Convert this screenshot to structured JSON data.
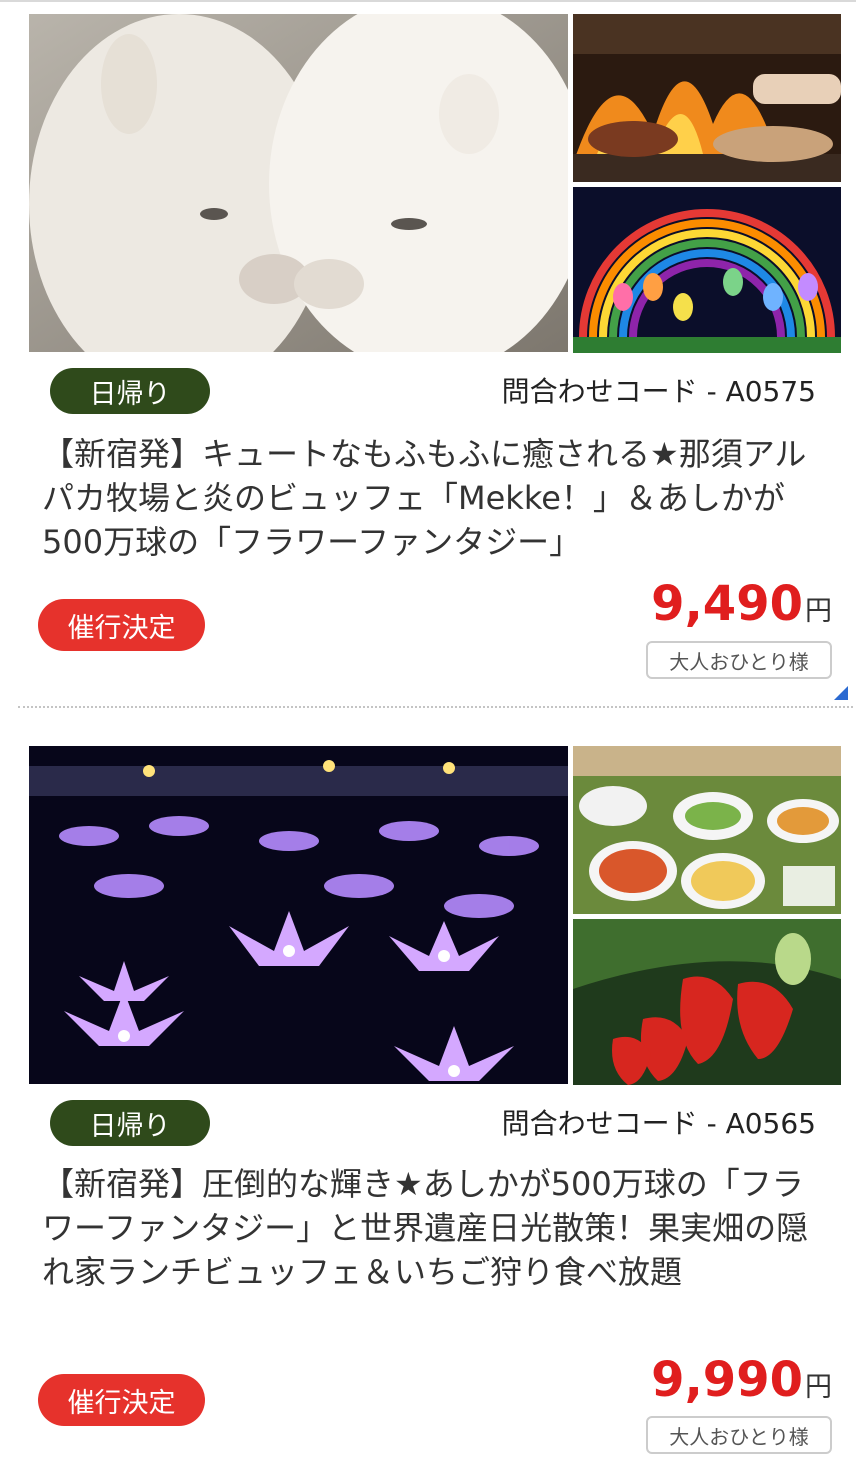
{
  "tours": [
    {
      "type_badge": "日帰り",
      "code": "問合わせコード - A0575",
      "title": "【新宿発】キュートなもふもふに癒される★那須アルパカ牧場と炎のビュッフェ「Mekke！」＆あしかが500万球の「フラワーファンタジー」",
      "status_badge": "催行決定",
      "price": "9,490",
      "currency": "円",
      "per_person": "大人おひとり様"
    },
    {
      "type_badge": "日帰り",
      "code": "問合わせコード - A0565",
      "title": "【新宿発】圧倒的な輝き★あしかが500万球の「フラワーファンタジー」と世界遺産日光散策！果実畑の隠れ家ランチビュッフェ＆いちご狩り食べ放題",
      "status_badge": "催行決定",
      "price": "9,990",
      "currency": "円",
      "per_person": "大人おひとり様"
    }
  ],
  "colors": {
    "day_badge": "#2f4a1b",
    "status_badge": "#e6322c",
    "price": "#e01e1e",
    "corner_accent": "#2b6ad1"
  }
}
